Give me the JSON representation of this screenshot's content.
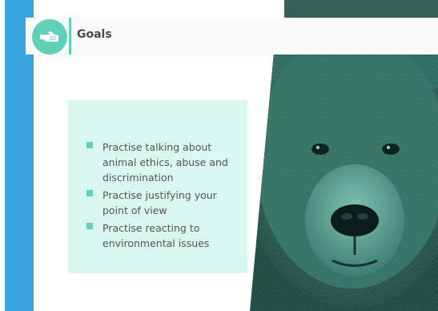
{
  "colors": {
    "accent_teal": "#5fd1b8",
    "blue_bar": "#3aa6e0",
    "card_bg": "#d9f7ee",
    "text": "#555555"
  },
  "header": {
    "icon": "pointing-hand-icon",
    "title": "Goals"
  },
  "goals": {
    "items": [
      {
        "text": "Practise talking about animal ethics, abuse and discrimination"
      },
      {
        "text": "Practise justifying your point of view"
      },
      {
        "text": "Practise reacting to environmental issues"
      }
    ]
  },
  "image": {
    "subject": "bear-photo"
  }
}
